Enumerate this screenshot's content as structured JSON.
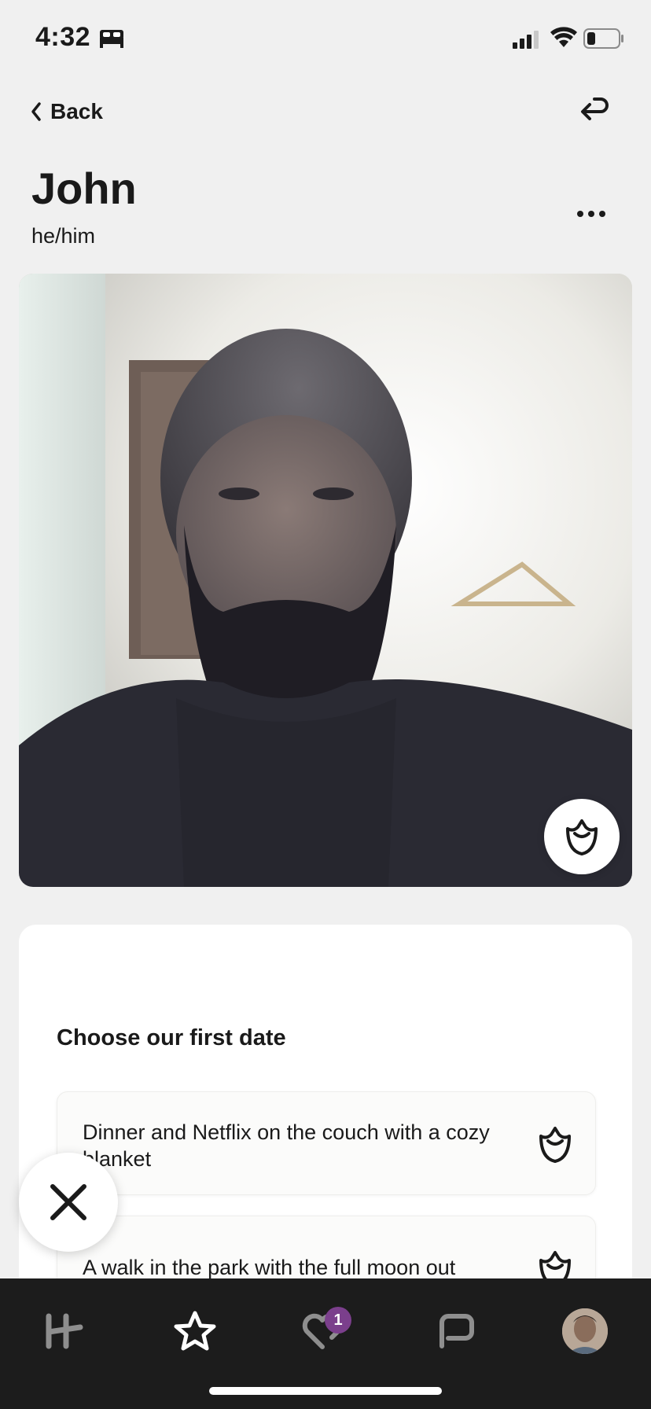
{
  "status_bar": {
    "time": "4:32",
    "icons": [
      "bed-icon",
      "signal-icon",
      "wifi-icon",
      "battery-icon"
    ]
  },
  "nav": {
    "back_label": "Back",
    "share_icon": "share-arrow-icon"
  },
  "profile": {
    "name": "John",
    "pronouns": "he/him",
    "more_icon": "more-icon"
  },
  "prompt": {
    "title": "Choose our first date",
    "options": [
      {
        "text": "Dinner and Netflix on the couch with a cozy blanket"
      },
      {
        "text": "A walk in the park with the full moon out"
      }
    ]
  },
  "tab_bar": {
    "tabs": [
      "tab-discover",
      "tab-standouts",
      "tab-likes",
      "tab-messages",
      "tab-profile"
    ],
    "likes_badge": "1"
  },
  "colors": {
    "background": "#f0f0f0",
    "card": "#ffffff",
    "tab_bar": "#1c1c1c",
    "badge": "#7b3f8c",
    "text": "#1a1a1a"
  }
}
